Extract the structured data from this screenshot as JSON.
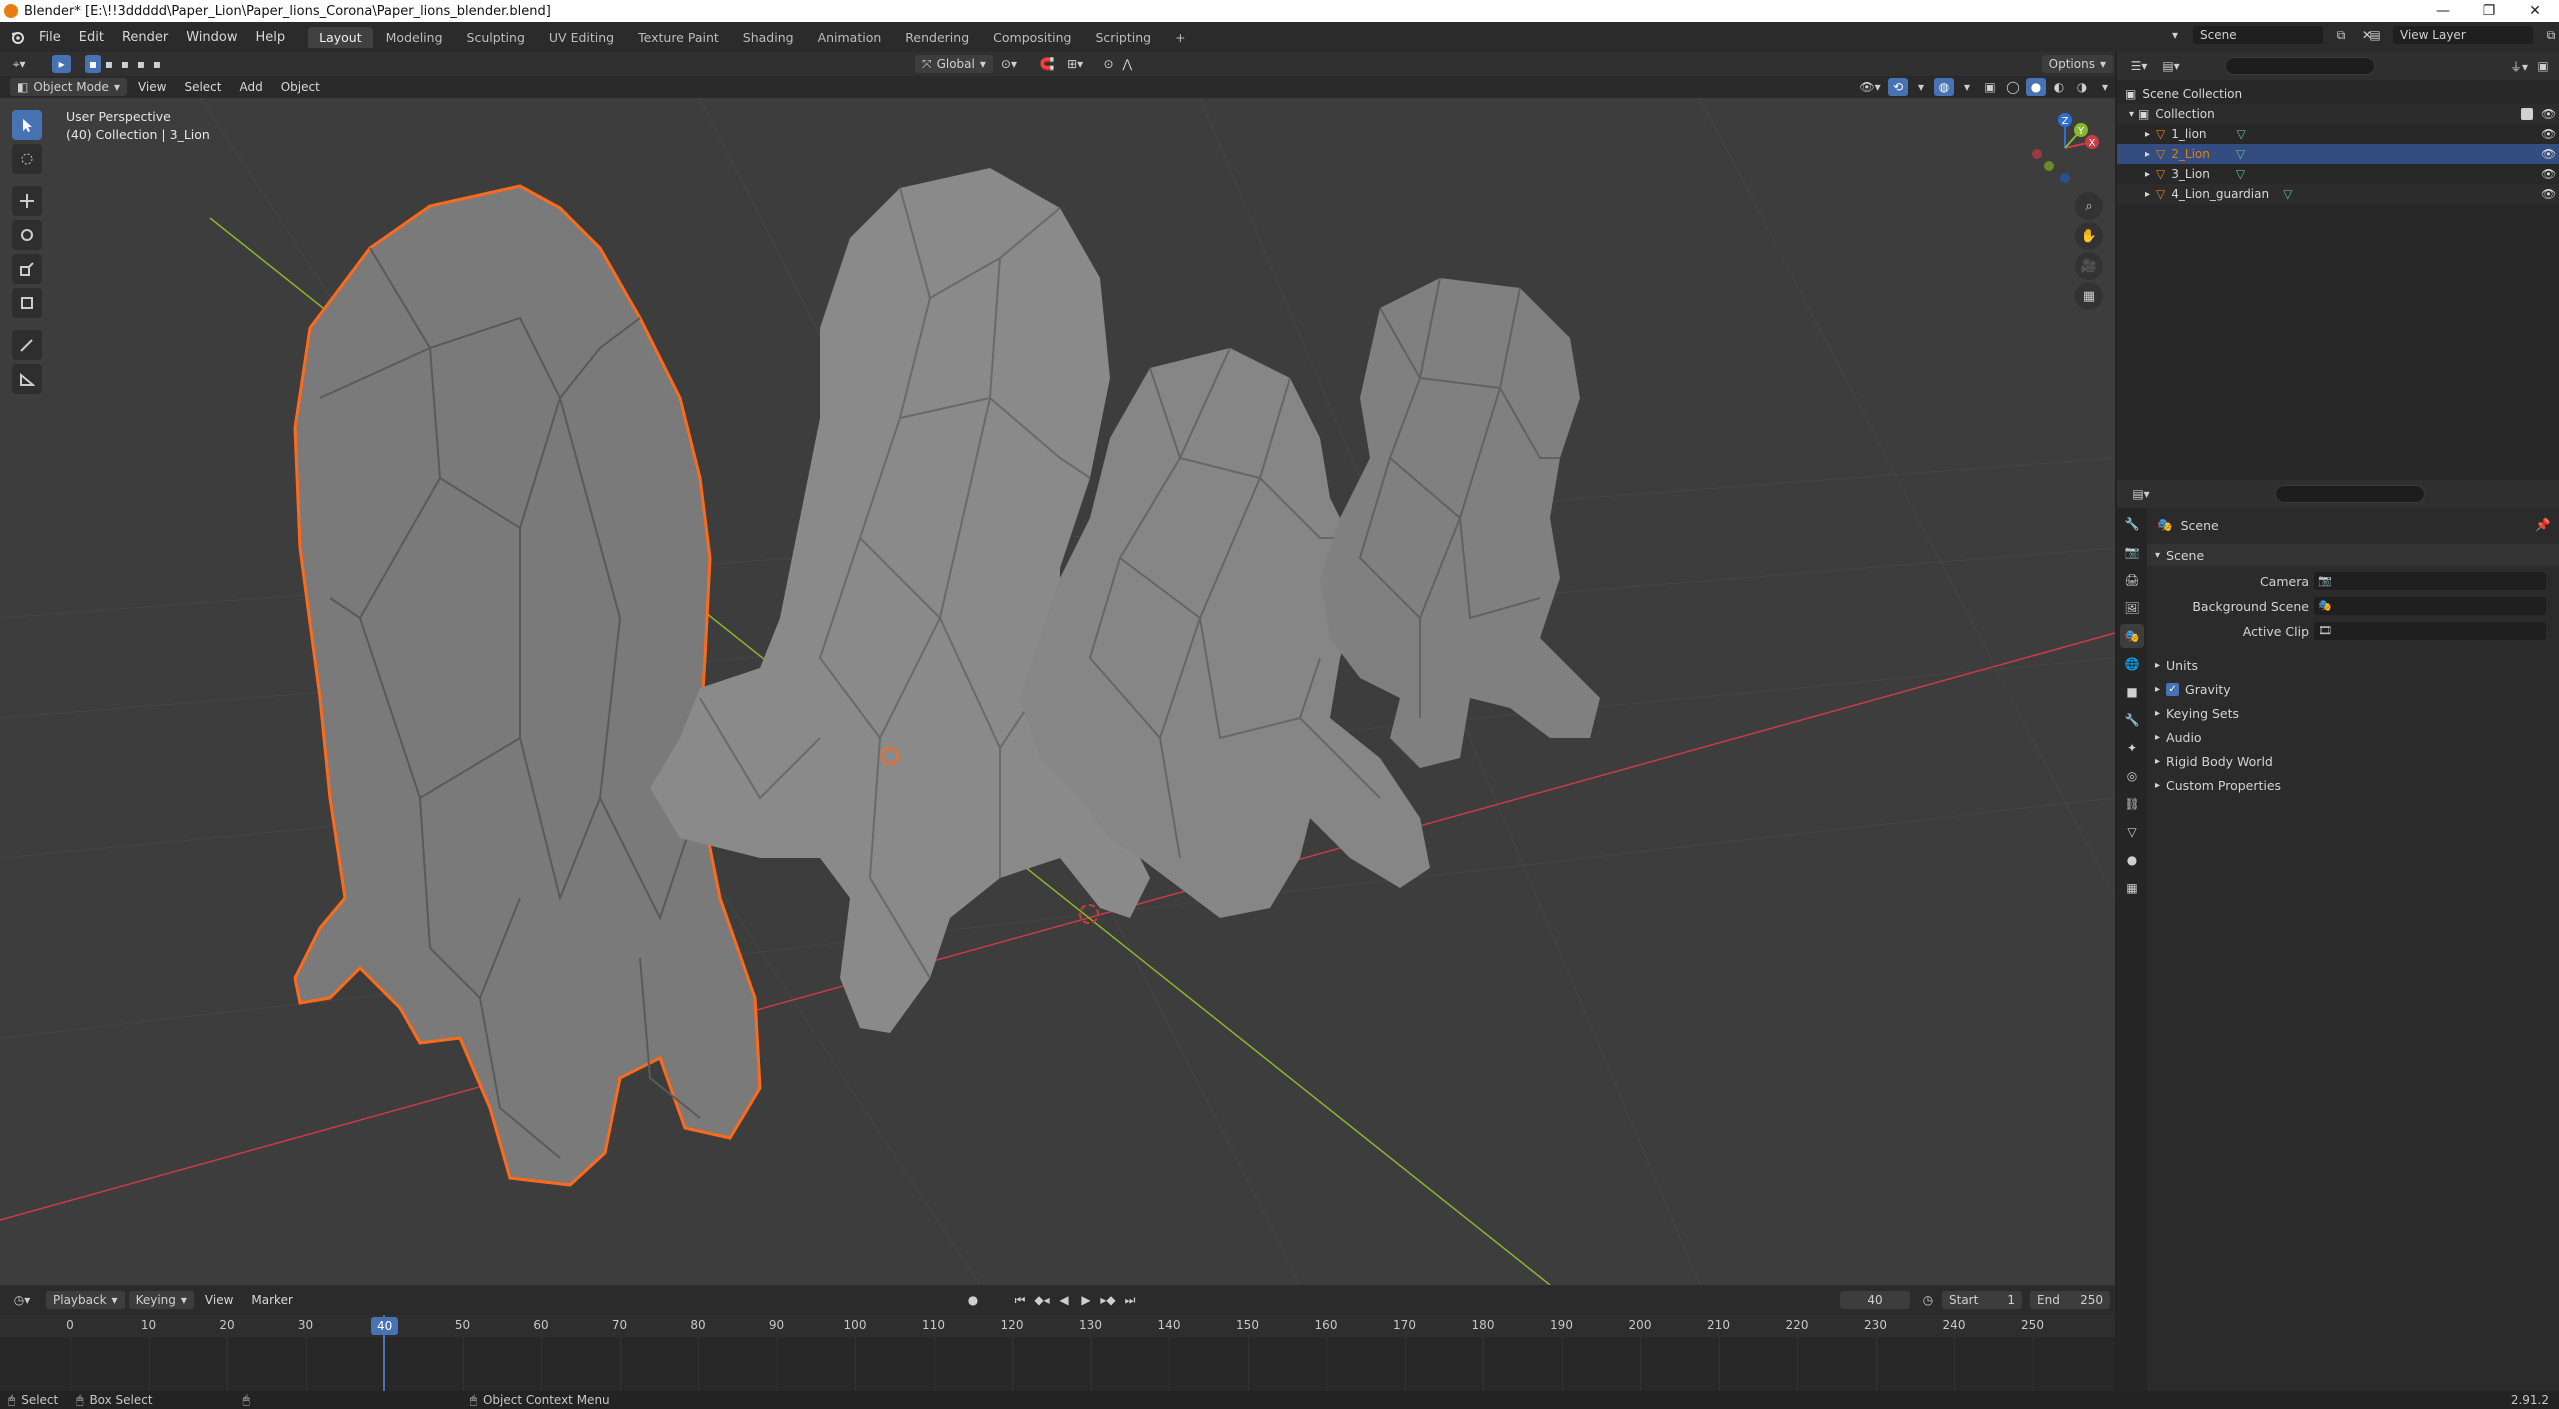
{
  "window": {
    "title": "Blender* [E:\\!!3ddddd\\Paper_Lion\\Paper_lions_Corona\\Paper_lions_blender.blend]",
    "minimize": "—",
    "maximize": "❐",
    "close": "✕"
  },
  "menu": {
    "items": [
      "File",
      "Edit",
      "Render",
      "Window",
      "Help"
    ],
    "workspaces": [
      "Layout",
      "Modeling",
      "Sculpting",
      "UV Editing",
      "Texture Paint",
      "Shading",
      "Animation",
      "Rendering",
      "Compositing",
      "Scripting"
    ],
    "active_workspace": "Layout",
    "add_tab": "+",
    "scene_label": "Scene",
    "view_layer_label": "View Layer"
  },
  "viewport_header": {
    "mode": "Object Mode",
    "menus": [
      "View",
      "Select",
      "Add",
      "Object"
    ],
    "orientation": "Global",
    "options": "Options"
  },
  "viewport": {
    "perspective": "User Perspective",
    "collection_info": "(40) Collection | 3_Lion",
    "gizmo_axes": [
      "X",
      "Y",
      "Z"
    ]
  },
  "timeline": {
    "menus": [
      "Playback",
      "Keying",
      "View",
      "Marker"
    ],
    "current_frame": "40",
    "start_label": "Start",
    "start": "1",
    "end_label": "End",
    "end": "250",
    "ticks": [
      "0",
      "10",
      "20",
      "30",
      "40",
      "50",
      "60",
      "70",
      "80",
      "90",
      "100",
      "110",
      "120",
      "130",
      "140",
      "150",
      "160",
      "170",
      "180",
      "190",
      "200",
      "210",
      "220",
      "230",
      "240",
      "250"
    ],
    "playhead": "40"
  },
  "outliner": {
    "scene_collection": "Scene Collection",
    "collection": "Collection",
    "items": [
      "1_lion",
      "2_Lion",
      "3_Lion",
      "4_Lion_guardian"
    ],
    "selected": "2_Lion"
  },
  "properties": {
    "context": "Scene",
    "panel": "Scene",
    "fields": [
      {
        "label": "Camera"
      },
      {
        "label": "Background Scene"
      },
      {
        "label": "Active Clip"
      }
    ],
    "subpanels": [
      "Units",
      "Gravity",
      "Keying Sets",
      "Audio",
      "Rigid Body World",
      "Custom Properties"
    ],
    "gravity_checked": true
  },
  "statusbar": {
    "select": "Select",
    "box_select": "Box Select",
    "context_menu": "Object Context Menu",
    "version": "2.91.2"
  },
  "colors": {
    "accent": "#4772b3",
    "selection_outline": "#ff6a1a",
    "x_axis": "#cc3b46",
    "y_axis": "#8ab82c",
    "active_text": "#e87d0d"
  }
}
